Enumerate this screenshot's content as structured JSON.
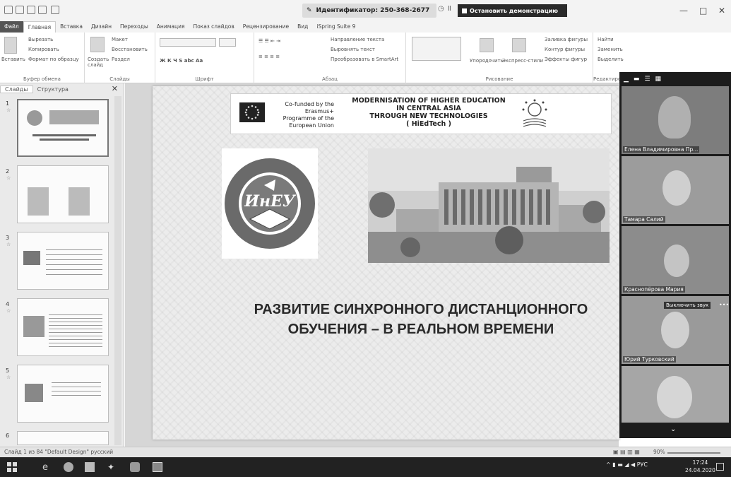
{
  "titlebar": {
    "meeting_id": "Идентификатор: 250-368-2677",
    "stop_demo": "Остановить демонстрацию"
  },
  "tabs": [
    "Файл",
    "Главная",
    "Вставка",
    "Дизайн",
    "Переходы",
    "Анимация",
    "Показ слайдов",
    "Рецензирование",
    "Вид",
    "iSpring Suite 9"
  ],
  "ribbon": {
    "clipboard": {
      "paste": "Вставить",
      "cut": "Вырезать",
      "copy": "Копировать",
      "format": "Формат по образцу",
      "label": "Буфер обмена"
    },
    "slides": {
      "create": "Создать слайд",
      "layout": "Макет",
      "reset": "Восстановить",
      "section": "Раздел",
      "label": "Слайды"
    },
    "font": {
      "label": "Шрифт"
    },
    "paragraph": {
      "text_dir": "Направление текста",
      "align_text": "Выровнять текст",
      "smartart": "Преобразовать в SmartArt",
      "label": "Абзац"
    },
    "drawing": {
      "arrange": "Упорядочить",
      "quick_styles": "Экспресс-стили",
      "fill": "Заливка фигуры",
      "outline": "Контур фигуры",
      "effects": "Эффекты фигур",
      "label": "Рисование"
    },
    "editing": {
      "find": "Найти",
      "replace": "Заменить",
      "select": "Выделить",
      "label": "Редактирование"
    }
  },
  "panel": {
    "tab_slides": "Слайды",
    "tab_outline": "Структура",
    "slide_numbers": [
      "1",
      "2",
      "3",
      "4",
      "5",
      "6"
    ]
  },
  "slide": {
    "eu_text": "Co-funded by the Erasmus+ Programme of the European Union",
    "hied_title_1": "MODERNISATION OF HIGHER EDUCATION",
    "hied_title_2": "IN CENTRAL ASIA",
    "hied_title_3": "THROUGH NEW TECHNOLOGIES",
    "hied_title_4": "( HiEdTech )",
    "uni_logo_text": "ИнЕУ",
    "title_1": "РАЗВИТИЕ СИНХРОННОГО ДИСТАНЦИОННОГО",
    "title_2": "ОБУЧЕНИЯ – В РЕАЛЬНОМ ВРЕМЕНИ"
  },
  "video": {
    "participants": [
      {
        "name": "Елена Владимировна Пр..."
      },
      {
        "name": "Тамара Салий"
      },
      {
        "name": "Краснопёрова Мария"
      },
      {
        "name": "Юрий Турковский"
      },
      {
        "name": ""
      }
    ],
    "mute_tip": "Выключить звук"
  },
  "status": {
    "text": "Слайд 1 из 84   \"Default Design\"   русский",
    "zoom": "90%"
  },
  "taskbar": {
    "lang": "РУС",
    "time": "17:24",
    "date": "24.04.2020"
  }
}
